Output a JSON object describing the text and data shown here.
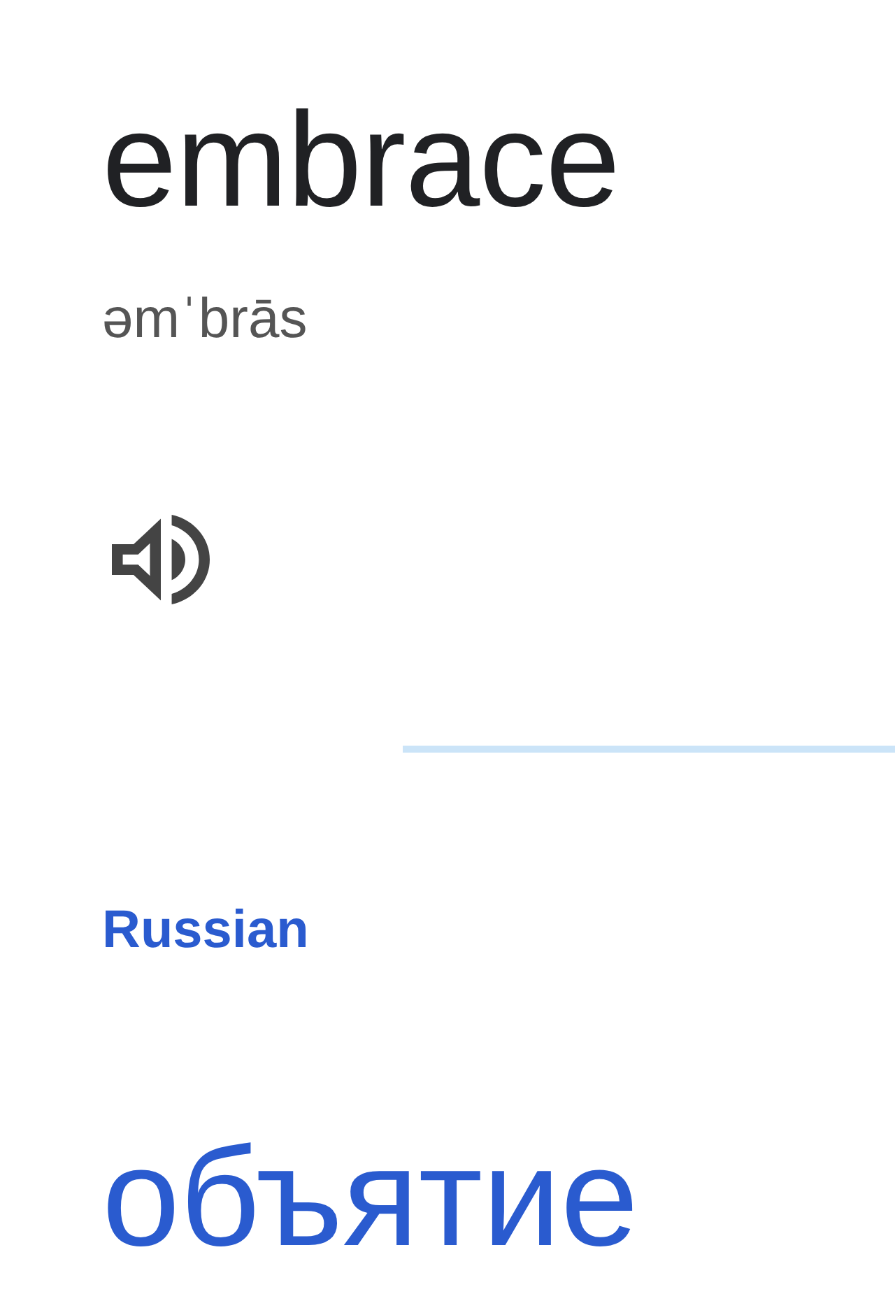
{
  "entry": {
    "word": "embrace",
    "phonetic": "əmˈbrās"
  },
  "translation": {
    "language": "Russian",
    "text": "объятие"
  }
}
